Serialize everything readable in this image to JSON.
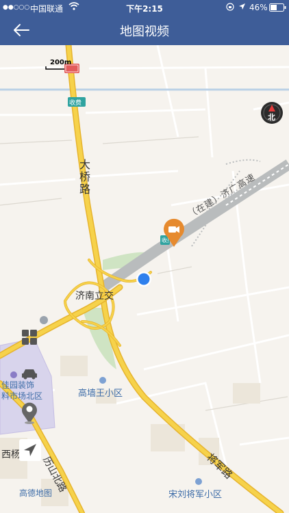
{
  "status_bar": {
    "signal": "●●○○○",
    "carrier": "中国联通",
    "time": "下午2:15",
    "battery": "46%"
  },
  "nav": {
    "title": "地图视频",
    "back_icon": "arrow-left-icon"
  },
  "map": {
    "scale_label": "200m",
    "compass_label": "北",
    "logo": "高德地图",
    "labels": {
      "daqiao_road": "大桥路",
      "jinan_interchange": "济南立交",
      "expressway": "（在建）济广高速",
      "toll1": "收费",
      "toll2": "收费",
      "gaoqiang": "高墙王小区",
      "jiayuan_line1": "佳园装饰",
      "jiayuan_line2": "料市场北区",
      "xiyang": "西杨家园",
      "lishan": "历山北路",
      "jiangjun": "将军路",
      "songliu": "宋刘将军小区"
    },
    "colors": {
      "road_major": "#f6d24b",
      "road_border": "#e6b32d",
      "expressway": "#b9bcbd",
      "marker": "#e68a2e",
      "location": "#2f80ed"
    }
  }
}
